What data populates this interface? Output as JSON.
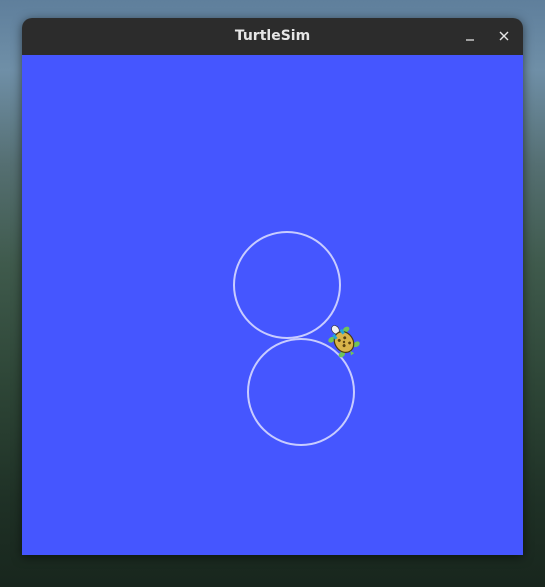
{
  "window": {
    "title": "TurtleSim",
    "minimize_icon": "minimize-icon",
    "close_icon": "close-icon"
  },
  "canvas": {
    "background_color": "#4556ff",
    "trail_color": "#c8ccff"
  },
  "turtle": {
    "icon": "turtle-icon"
  }
}
